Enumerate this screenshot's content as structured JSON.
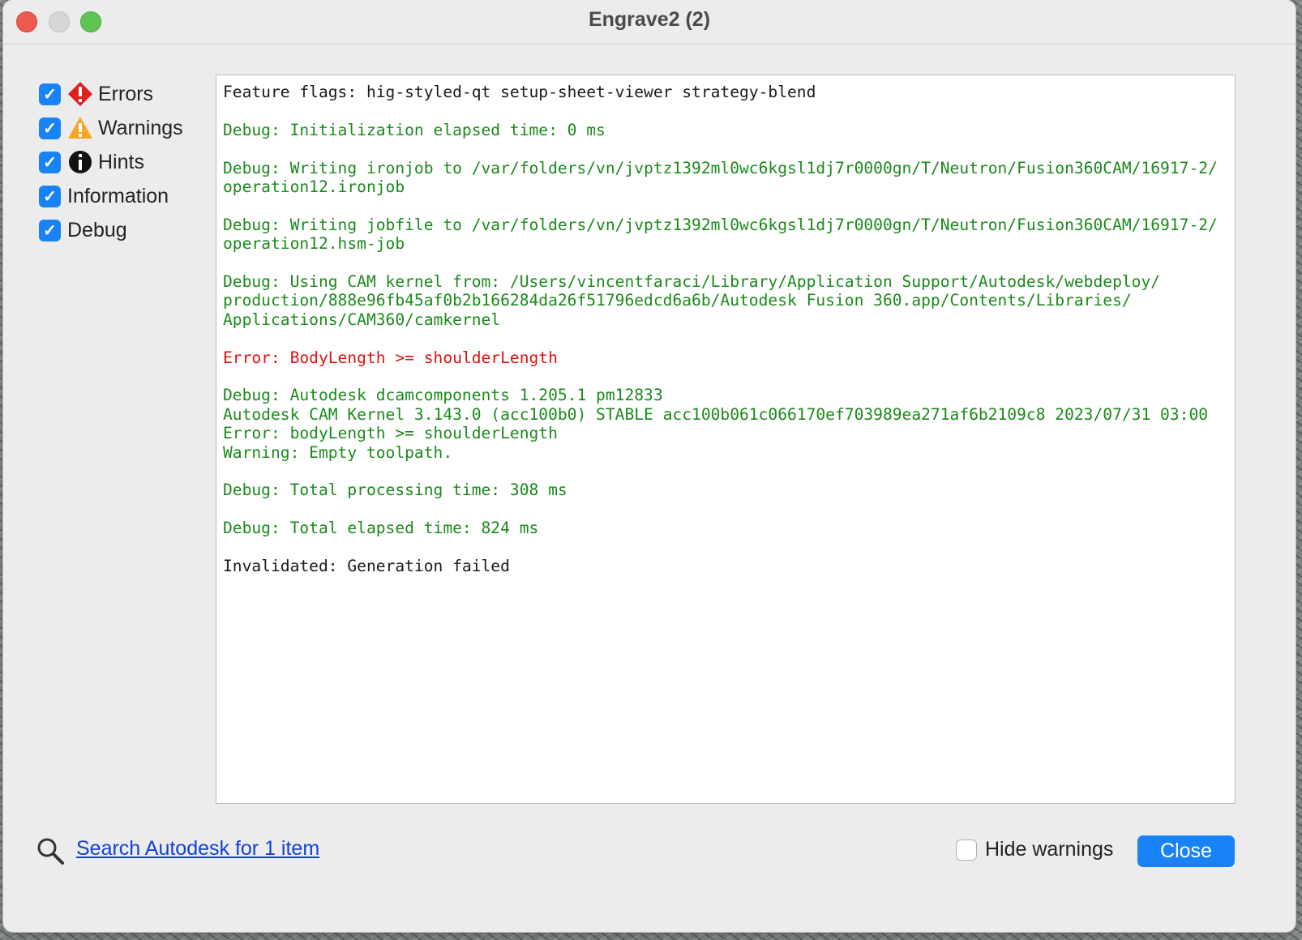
{
  "window": {
    "title": "Engrave2 (2)"
  },
  "filters": [
    {
      "label": "Errors",
      "checked": true,
      "icon": "error-diamond-icon"
    },
    {
      "label": "Warnings",
      "checked": true,
      "icon": "warning-triangle-icon"
    },
    {
      "label": "Hints",
      "checked": true,
      "icon": "info-circle-icon"
    },
    {
      "label": "Information",
      "checked": true,
      "icon": ""
    },
    {
      "label": "Debug",
      "checked": true,
      "icon": ""
    }
  ],
  "log": {
    "entries": [
      {
        "text": "Feature flags: hig-styled-qt setup-sheet-viewer strategy-blend",
        "level": "info"
      },
      {
        "text": "Debug: Initialization elapsed time: 0 ms",
        "level": "debug"
      },
      {
        "text": "Debug: Writing ironjob to /var/folders/vn/jvptz1392ml0wc6kgsl1dj7r0000gn/T/Neutron/Fusion360CAM/16917-2/\noperation12.ironjob",
        "level": "debug"
      },
      {
        "text": "Debug: Writing jobfile to /var/folders/vn/jvptz1392ml0wc6kgsl1dj7r0000gn/T/Neutron/Fusion360CAM/16917-2/\noperation12.hsm-job",
        "level": "debug"
      },
      {
        "text": "Debug: Using CAM kernel from: /Users/vincentfaraci/Library/Application Support/Autodesk/webdeploy/\nproduction/888e96fb45af0b2b166284da26f51796edcd6a6b/Autodesk Fusion 360.app/Contents/Libraries/\nApplications/CAM360/camkernel",
        "level": "debug"
      },
      {
        "text": "Error: BodyLength >= shoulderLength",
        "level": "error"
      },
      {
        "text": "Debug: Autodesk dcamcomponents 1.205.1 pm12833\nAutodesk CAM Kernel 3.143.0 (acc100b0) STABLE acc100b061c066170ef703989ea271af6b2109c8 2023/07/31 03:00\nError: bodyLength >= shoulderLength\nWarning: Empty toolpath.",
        "level": "debug"
      },
      {
        "text": "Debug: Total processing time: 308 ms",
        "level": "debug"
      },
      {
        "text": "Debug: Total elapsed time: 824 ms",
        "level": "debug"
      },
      {
        "text": "Invalidated: Generation failed",
        "level": "info"
      }
    ]
  },
  "footer": {
    "search_link": "Search Autodesk for 1 item",
    "hide_warnings_label": "Hide warnings",
    "hide_warnings_checked": false,
    "close_label": "Close"
  },
  "colors": {
    "accent": "#1a82f7",
    "debug_text": "#1a8a1a",
    "error_text": "#e01010",
    "link": "#1340d8"
  }
}
